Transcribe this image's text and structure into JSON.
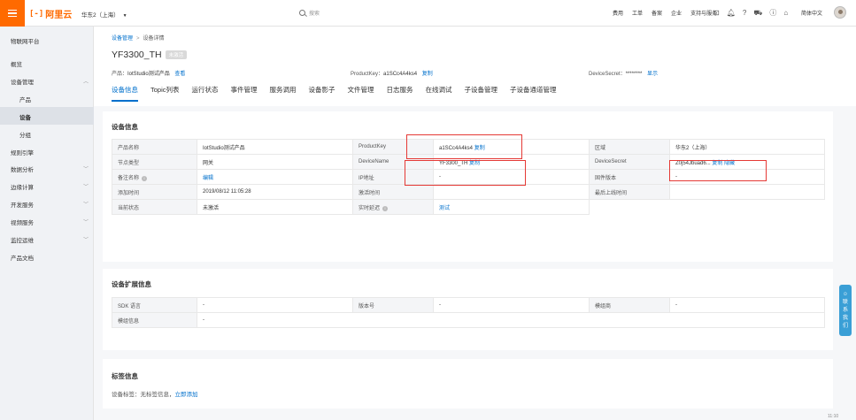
{
  "topbar": {
    "brand": "阿里云",
    "region": "华东2（上海）",
    "search_placeholder": "搜索",
    "nav": [
      "费用",
      "工单",
      "备案",
      "企业",
      "支持与服务"
    ],
    "language": "简体中文"
  },
  "sidebar": {
    "title": "物联网平台",
    "items": [
      {
        "label": "概览"
      },
      {
        "label": "设备管理"
      },
      {
        "label": "产品"
      },
      {
        "label": "设备"
      },
      {
        "label": "分组"
      },
      {
        "label": "规则引擎"
      },
      {
        "label": "数据分析"
      },
      {
        "label": "边缘计算"
      },
      {
        "label": "开发服务"
      },
      {
        "label": "视频服务"
      },
      {
        "label": "监控运维"
      },
      {
        "label": "产品文档"
      }
    ]
  },
  "breadcrumb": {
    "parent": "设备管理",
    "current": "设备详情"
  },
  "device": {
    "name": "YF3300_TH",
    "status_badge": "未激活",
    "product_label": "产品：",
    "product_value": "IotStudio测试产品",
    "view_link": "查看",
    "productkey_label": "ProductKey：",
    "productkey_value": "a1SCc4A4ks4",
    "copy_link": "复制",
    "secret_label": "DeviceSecret：",
    "secret_value": "********",
    "show_link": "显示"
  },
  "tabs": [
    "设备信息",
    "Topic列表",
    "运行状态",
    "事件管理",
    "服务调用",
    "设备影子",
    "文件管理",
    "日志服务",
    "在线调试",
    "子设备管理",
    "子设备通道管理"
  ],
  "device_info": {
    "title": "设备信息",
    "rows": [
      [
        "产品名称",
        "IotStudio测试产品",
        "ProductKey",
        "a1SCc4A4ks4",
        "区域",
        "华东2（上海）"
      ],
      [
        "节点类型",
        "网关",
        "DeviceName",
        "YF3300_TH",
        "DeviceSecret",
        "Z0j54Jbuad6..."
      ],
      [
        "备注名称",
        "编辑",
        "IP地址",
        "-",
        "固件版本",
        "-"
      ],
      [
        "添加时间",
        "2019/08/12 11:05:28",
        "激活时间",
        "",
        "最后上线时间",
        ""
      ],
      [
        "当前状态",
        "未激活",
        "实时延迟",
        "测试",
        "",
        ""
      ]
    ],
    "copy": "复制",
    "hide": "隐藏"
  },
  "ext_info": {
    "title": "设备扩展信息",
    "rows": [
      [
        "SDK 语言",
        "-",
        "版本号",
        "-",
        "模组商",
        "-"
      ],
      [
        "模组信息",
        "-",
        "",
        "",
        "",
        ""
      ]
    ]
  },
  "tag_info": {
    "title": "标签信息",
    "label": "设备标签：无标签信息，",
    "add_link": "立即添加"
  },
  "float_contact": [
    "联",
    "系",
    "我",
    "们"
  ],
  "clock": "11:10"
}
